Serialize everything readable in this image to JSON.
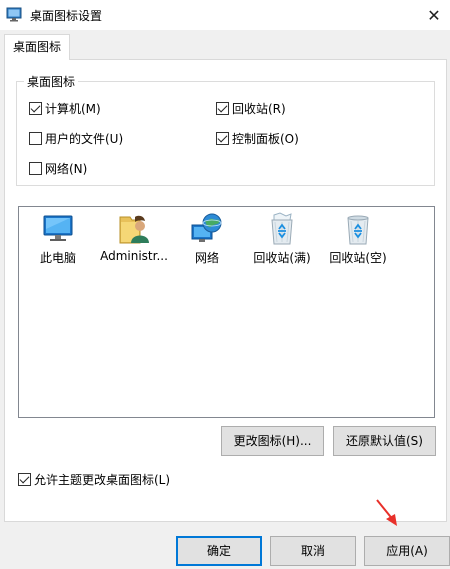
{
  "window": {
    "title": "桌面图标设置",
    "close_glyph": "✕",
    "icon": "desktop-settings-icon"
  },
  "tabs": [
    {
      "label": "桌面图标",
      "selected": true
    }
  ],
  "group": {
    "legend": "桌面图标",
    "checkboxes": [
      {
        "label": "计算机(M)",
        "checked": true
      },
      {
        "label": "回收站(R)",
        "checked": true
      },
      {
        "label": "用户的文件(U)",
        "checked": false
      },
      {
        "label": "控制面板(O)",
        "checked": true
      },
      {
        "label": "网络(N)",
        "checked": false
      }
    ]
  },
  "icons": [
    {
      "label": "此电脑",
      "icon": "computer-icon"
    },
    {
      "label": "Administr...",
      "icon": "user-folder-icon"
    },
    {
      "label": "网络",
      "icon": "network-icon"
    },
    {
      "label": "回收站(满)",
      "icon": "recycle-bin-full-icon"
    },
    {
      "label": "回收站(空)",
      "icon": "recycle-bin-empty-icon"
    }
  ],
  "buttons": {
    "change_icon": "更改图标(H)...",
    "restore_default": "还原默认值(S)",
    "ok": "确定",
    "cancel": "取消",
    "apply": "应用(A)"
  },
  "allow_themes": {
    "label": "允许主题更改桌面图标(L)",
    "checked": true
  },
  "colors": {
    "accent": "#0078d7",
    "annotation_arrow": "#e8302a"
  }
}
